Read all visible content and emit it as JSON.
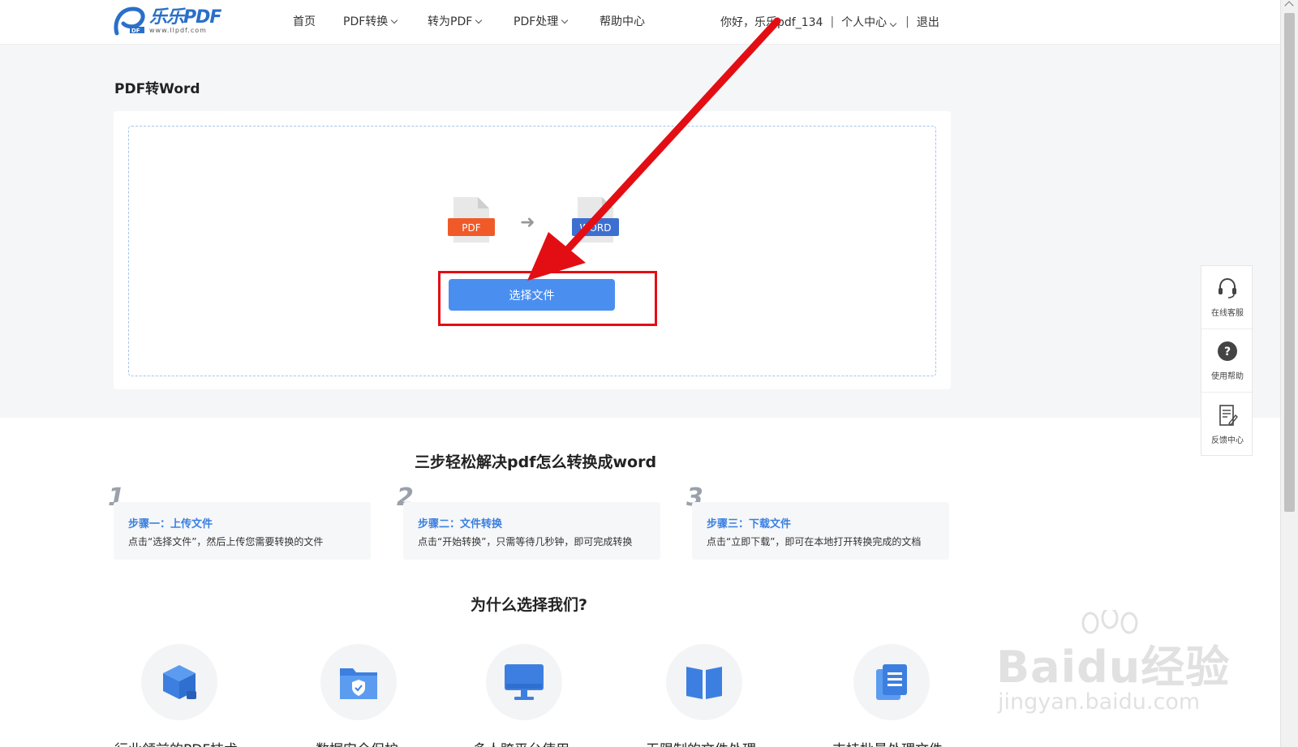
{
  "header": {
    "logo_name": "乐乐PDF",
    "logo_url": "www.llpdf.com",
    "nav": [
      {
        "label": "首页",
        "dropdown": false
      },
      {
        "label": "PDF转换",
        "dropdown": true
      },
      {
        "label": "转为PDF",
        "dropdown": true
      },
      {
        "label": "PDF处理",
        "dropdown": true
      },
      {
        "label": "帮助中心",
        "dropdown": false
      }
    ],
    "greeting": "你好，乐乐pdf_134",
    "account_label": "个人中心",
    "logout_label": "退出"
  },
  "upload": {
    "page_title": "PDF转Word",
    "source_format": "PDF",
    "target_format": "WORD",
    "select_button": "选择文件"
  },
  "steps": {
    "title": "三步轻松解决pdf怎么转换成word",
    "items": [
      {
        "num": "1",
        "title": "步骤一：上传文件",
        "desc": "点击“选择文件”，然后上传您需要转换的文件"
      },
      {
        "num": "2",
        "title": "步骤二：文件转换",
        "desc": "点击“开始转换”，只需等待几秒钟，即可完成转换"
      },
      {
        "num": "3",
        "title": "步骤三：下载文件",
        "desc": "点击“立即下载”，即可在本地打开转换完成的文档"
      }
    ]
  },
  "features": {
    "title": "为什么选择我们?",
    "items": [
      {
        "icon": "cube-icon",
        "label": "行业领前的PDF技术"
      },
      {
        "icon": "secure-folder-icon",
        "label": "数据安全保护"
      },
      {
        "icon": "monitor-icon",
        "label": "多人跨平台使用"
      },
      {
        "icon": "book-icon",
        "label": "无限制的文件处理"
      },
      {
        "icon": "documents-icon",
        "label": "支持批量处理文件"
      }
    ]
  },
  "side_panel": {
    "items": [
      {
        "icon": "headset-icon",
        "label": "在线客服"
      },
      {
        "icon": "help-icon",
        "label": "使用帮助"
      },
      {
        "icon": "feedback-icon",
        "label": "反馈中心"
      }
    ]
  },
  "watermark": {
    "main": "Baidu经验",
    "sub": "jingyan.baidu.com"
  },
  "colors": {
    "accent": "#4a8ff0",
    "annotation_red": "#e30e14",
    "pdf_orange": "#f05a28",
    "word_blue": "#3d6fd1"
  }
}
